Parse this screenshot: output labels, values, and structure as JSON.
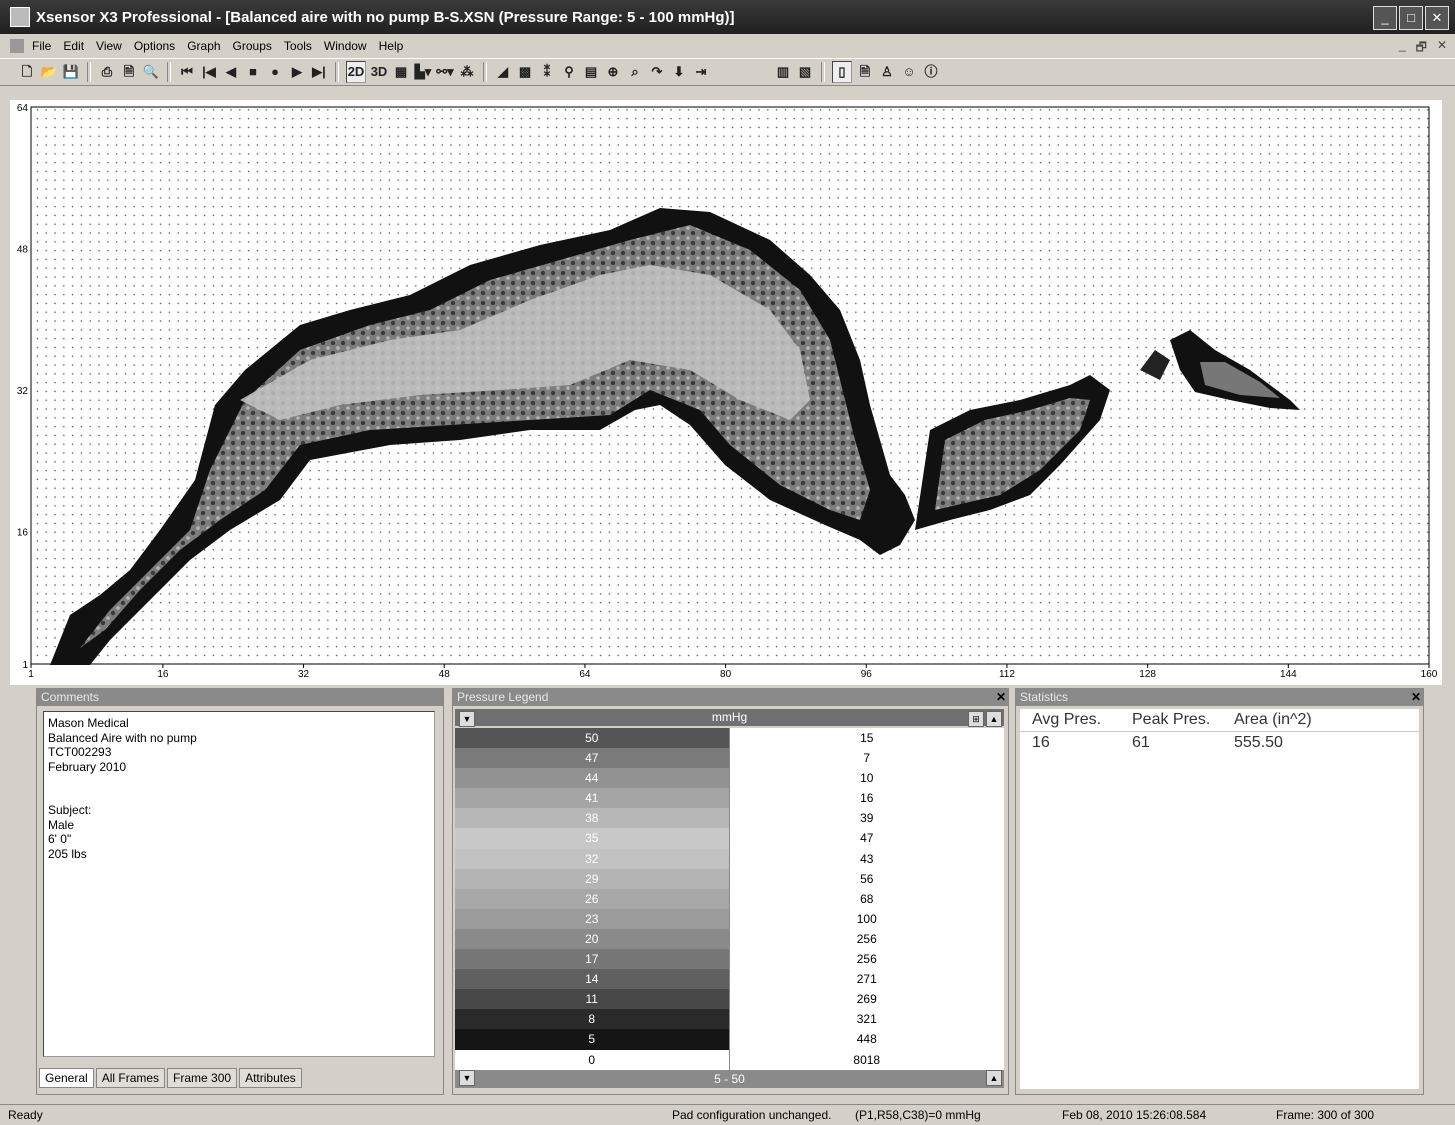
{
  "window": {
    "title": "Xsensor X3 Professional - [Balanced aire with no pump B-S.XSN  (Pressure Range: 5 - 100 mmHg)]",
    "controls": [
      "_",
      "□",
      "✕"
    ]
  },
  "menu": [
    "File",
    "Edit",
    "View",
    "Options",
    "Graph",
    "Groups",
    "Tools",
    "Window",
    "Help"
  ],
  "mdi_controls": [
    "_",
    "🗗",
    "✕"
  ],
  "toolbar": {
    "btn_2d": "2D",
    "btn_3d": "3D",
    "icons": [
      "new-icon",
      "open-icon",
      "save-icon",
      "print-icon",
      "print-preview-icon",
      "preview-icon",
      "first-frame-icon",
      "prev-step-icon",
      "prev-frame-icon",
      "stop-icon",
      "record-icon",
      "next-frame-icon",
      "last-frame-icon"
    ]
  },
  "plot": {
    "y_ticks": [
      "64",
      "48",
      "32",
      "16",
      "1"
    ],
    "x_ticks": [
      "1",
      "16",
      "32",
      "48",
      "64",
      "80",
      "96",
      "112",
      "128",
      "144",
      "160"
    ],
    "xlim": [
      1,
      160
    ],
    "ylim": [
      1,
      64
    ],
    "grid": true
  },
  "comments": {
    "title": "Comments",
    "text": "Mason Medical\nBalanced Aire with no pump\nTCT002293\nFebruary 2010\n\n\nSubject:\nMale\n6' 0\"\n205 lbs",
    "tabs": [
      "General",
      "All Frames",
      "Frame 300",
      "Attributes"
    ]
  },
  "legend": {
    "title": "Pressure Legend",
    "unit": "mmHg",
    "range": "5 - 50",
    "rows": [
      {
        "value": "50",
        "count": "15",
        "color": "#555555"
      },
      {
        "value": "47",
        "count": "7",
        "color": "#7a7a7a"
      },
      {
        "value": "44",
        "count": "10",
        "color": "#929292"
      },
      {
        "value": "41",
        "count": "16",
        "color": "#a5a5a5"
      },
      {
        "value": "38",
        "count": "39",
        "color": "#b7b7b7"
      },
      {
        "value": "35",
        "count": "47",
        "color": "#c8c8c8"
      },
      {
        "value": "32",
        "count": "43",
        "color": "#c2c2c2"
      },
      {
        "value": "29",
        "count": "56",
        "color": "#b4b4b4"
      },
      {
        "value": "26",
        "count": "68",
        "color": "#a8a8a8"
      },
      {
        "value": "23",
        "count": "100",
        "color": "#9b9b9b"
      },
      {
        "value": "20",
        "count": "256",
        "color": "#8a8a8a"
      },
      {
        "value": "17",
        "count": "256",
        "color": "#777777"
      },
      {
        "value": "14",
        "count": "271",
        "color": "#606060"
      },
      {
        "value": "11",
        "count": "269",
        "color": "#474747"
      },
      {
        "value": "8",
        "count": "321",
        "color": "#2a2a2a"
      },
      {
        "value": "5",
        "count": "448",
        "color": "#151515"
      },
      {
        "value": "0",
        "count": "8018",
        "color": "#ffffff"
      }
    ]
  },
  "statistics": {
    "title": "Statistics",
    "columns": [
      "Avg Pres.",
      "Peak Pres.",
      "Area (in^2)"
    ],
    "values": [
      "16",
      "61",
      "555.50"
    ]
  },
  "status": {
    "ready": "Ready",
    "pad": "Pad configuration unchanged.",
    "cell": "(P1,R58,C38)=0 mmHg",
    "timestamp": "Feb 08, 2010  15:26:08.584",
    "frame": "Frame: 300 of 300"
  }
}
